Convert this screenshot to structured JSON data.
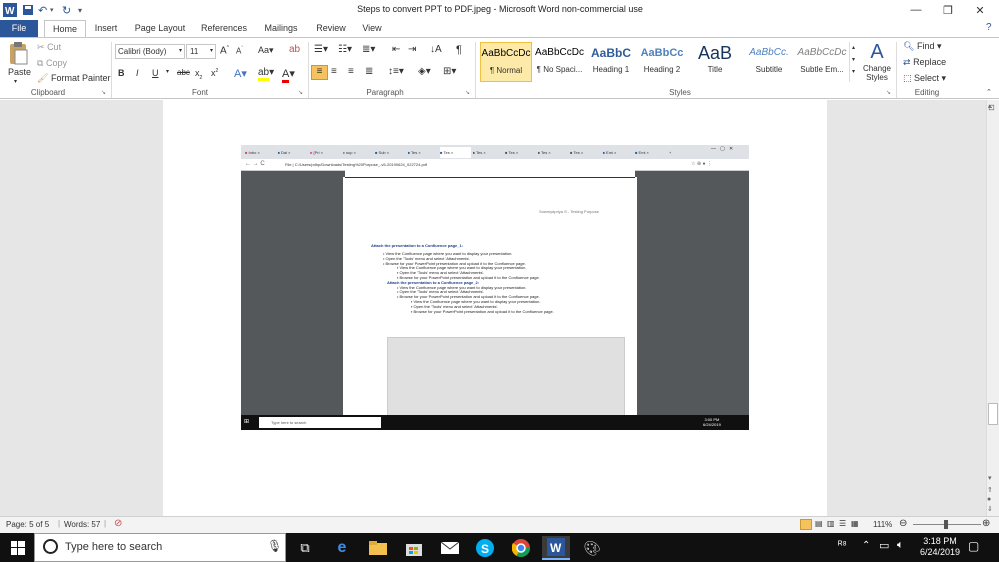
{
  "window": {
    "title": "Steps to convert PPT to PDF.jpeg  -  Microsoft Word non-commercial use"
  },
  "tabs": [
    "File",
    "Home",
    "Insert",
    "Page Layout",
    "References",
    "Mailings",
    "Review",
    "View"
  ],
  "clipboard": {
    "paste": "Paste",
    "cut": "Cut",
    "copy": "Copy",
    "format_painter": "Format Painter",
    "label": "Clipboard"
  },
  "font": {
    "name": "Calibri (Body)",
    "size": "11",
    "label": "Font"
  },
  "paragraph": {
    "label": "Paragraph"
  },
  "styles": {
    "label": "Styles",
    "items": [
      {
        "sample": "AaBbCcDc",
        "name": "¶ Normal"
      },
      {
        "sample": "AaBbCcDc",
        "name": "¶ No Spaci..."
      },
      {
        "sample": "AaBbC",
        "name": "Heading 1"
      },
      {
        "sample": "AaBbCc",
        "name": "Heading 2"
      },
      {
        "sample": "AaB",
        "name": "Title"
      },
      {
        "sample": "AaBbCc.",
        "name": "Subtitle"
      },
      {
        "sample": "AaBbCcDc",
        "name": "Subtle Em..."
      }
    ],
    "change_styles": "Change Styles"
  },
  "editing": {
    "find": "Find",
    "replace": "Replace",
    "select": "Select",
    "label": "Editing"
  },
  "status": {
    "page": "Page: 5 of 5",
    "words": "Words: 57",
    "zoom": "111%"
  },
  "taskbar": {
    "search_placeholder": "Type here to search",
    "time": "3:18 PM",
    "date": "6/24/2019"
  },
  "embedded": {
    "tabs": [
      "Inbo",
      "Dai",
      "[Pri",
      "sup",
      "Sub",
      "Tes",
      "Tes",
      "Tes",
      "Tes",
      "Tes",
      "Tes",
      "Emi",
      "Emi"
    ],
    "address": "File  |  C:/Users/pdhp/Downloads/Testing%20Purpose_-v5-20190624_022724.pdf",
    "page_header": "Sowmyapriya S  -  Testing Purpose",
    "heading1": "Attach the presentation to a Confluence page_1:",
    "bullets1": [
      "View the Confluence page where you want to display your presentation.",
      "Open the 'Tools' menu and select 'Attachments'.",
      "Browse for your PowerPoint presentation and upload it to the Confluence page."
    ],
    "bullets1b": [
      "View the Confluence page where you want to display your presentation.",
      "Open the 'Tools' menu and select 'Attachments'.",
      "Browse for your PowerPoint presentation and upload it to the Confluence page."
    ],
    "heading2": "Attach the presentation to a Confluence page_2:",
    "bullets2": [
      "View the Confluence page where you want to display your presentation.",
      "Open the 'Tools' menu and select 'Attachments'.",
      "Browse for your PowerPoint presentation and upload it to the Confluence page."
    ],
    "bullets2b": [
      "View the Confluence page where you want to display your presentation.",
      "Open the 'Tools' menu and select 'Attachments'.",
      "Browse for your PowerPoint presentation and upload it to the Confluence page."
    ],
    "search_placeholder": "Type here to search",
    "time": "3:00 PM",
    "date": "6/24/2019"
  },
  "colors": {
    "accent": "#2b579a",
    "taskbar": "#101010"
  }
}
